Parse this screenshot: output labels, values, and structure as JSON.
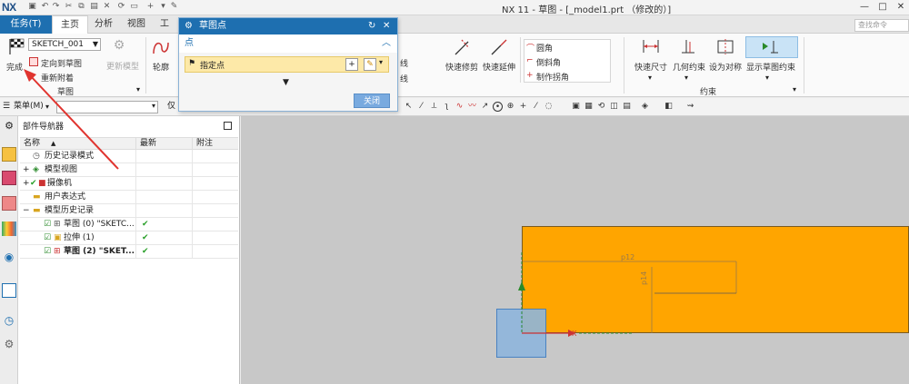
{
  "window": {
    "logo": "NX",
    "title": "NX 11 - 草图 - [_model1.prt （修改的）]"
  },
  "tabs": {
    "task": "任务(T)",
    "home": "主页",
    "analysis": "分析",
    "view": "视图",
    "tools_partial": "工"
  },
  "search": {
    "placeholder": "查找命令"
  },
  "ribbon": {
    "finish_label": "完成",
    "sketch_name": "SKETCH_001",
    "orient_to_sketch": "定向到草图",
    "reattach": "重新附着",
    "update_model": "更新模型",
    "group_sketch": "草图",
    "contour": "轮廓",
    "line_partial_1": "线",
    "line_partial_2": "线",
    "quick_trim": "快速修剪",
    "quick_extend": "快速延伸",
    "fillet": "圆角",
    "chamfer": "倒斜角",
    "make_corner": "制作拐角",
    "quick_dimension": "快速尺寸",
    "geometric_constraints": "几何约束",
    "make_symmetric": "设为对称",
    "show_sketch_constraints": "显示草图约束",
    "group_constraints": "约束"
  },
  "selbar": {
    "menu": "菜单(M)",
    "partial": "仅"
  },
  "navigator": {
    "title": "部件导航器",
    "columns": [
      "名称",
      "最新",
      "附注"
    ],
    "rows": [
      {
        "label": "历史记录模式",
        "latest": "",
        "bold": false
      },
      {
        "label": "模型视图",
        "latest": "",
        "bold": false
      },
      {
        "label": "摄像机",
        "latest": "",
        "bold": false
      },
      {
        "label": "用户表达式",
        "latest": "",
        "bold": false
      },
      {
        "label": "模型历史记录",
        "latest": "",
        "bold": false
      },
      {
        "label": "草图 (0) \"SKETC...",
        "latest": "✔",
        "bold": false
      },
      {
        "label": "拉伸 (1)",
        "latest": "✔",
        "bold": false
      },
      {
        "label": "草图 (2) \"SKET...",
        "latest": "✔",
        "bold": true
      }
    ]
  },
  "dialog": {
    "title": "草图点",
    "section": "点",
    "specify_point": "指定点",
    "close_button": "关闭"
  },
  "canvas": {
    "dim_horizontal": "p12",
    "dim_vertical": "p14",
    "axis_x": "X"
  },
  "colors": {
    "accent": "#1e6fb0",
    "sketch_body": "#ffa500",
    "highlight_row": "#fde9a8",
    "annotation_arrow": "#e0342f"
  }
}
